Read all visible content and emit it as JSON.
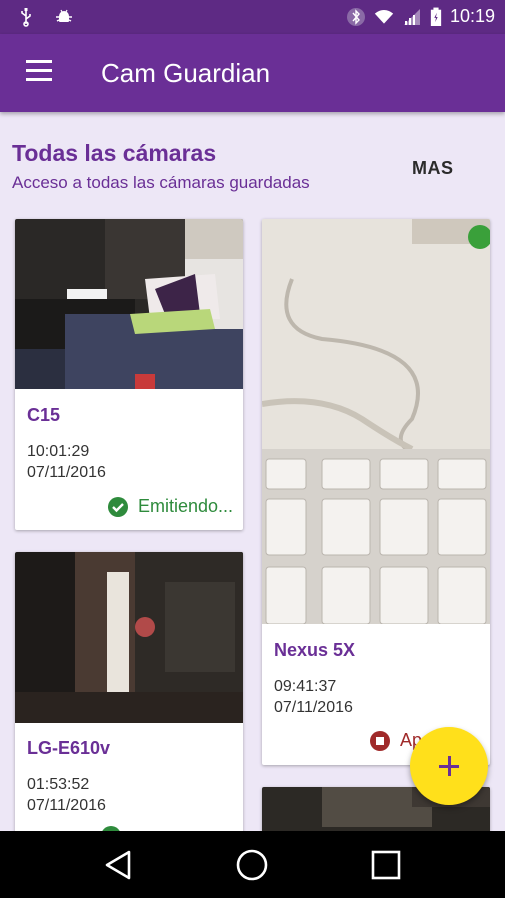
{
  "status_bar": {
    "time": "10:19",
    "left_icons": [
      "usb-icon",
      "android-debug-icon"
    ],
    "right_icons": [
      "bluetooth-icon",
      "wifi-icon",
      "signal-icon",
      "battery-icon"
    ]
  },
  "app_bar": {
    "title": "Cam Guardian",
    "menu_icon": "menu-icon"
  },
  "section": {
    "title": "Todas las cámaras",
    "subtitle": "Acceso a todas las cámaras guardadas",
    "more_label": "MAS"
  },
  "cameras": [
    {
      "name": "C15",
      "time": "10:01:29",
      "date": "07/11/2016",
      "status": "Emitiendo...",
      "status_icon": "check-circle-icon",
      "status_color": "#2e8b3c"
    },
    {
      "name": "Nexus 5X",
      "time": "09:41:37",
      "date": "07/11/2016",
      "status": "Ap",
      "status_icon": "stop-circle-icon",
      "status_color": "#a02a2a"
    },
    {
      "name": "LG-E610v",
      "time": "01:53:52",
      "date": "07/11/2016",
      "status": "",
      "status_icon": "check-circle-icon",
      "status_color": "#2e8b3c"
    }
  ],
  "fab": {
    "icon": "plus-icon",
    "color": "#ffe01b"
  },
  "nav_bar": {
    "icons": [
      "back-icon",
      "home-icon",
      "recents-icon"
    ]
  },
  "colors": {
    "primary": "#6a2f96",
    "primary_dark": "#5e2a84",
    "background": "#ede7f6",
    "accent": "#ffe01b"
  }
}
